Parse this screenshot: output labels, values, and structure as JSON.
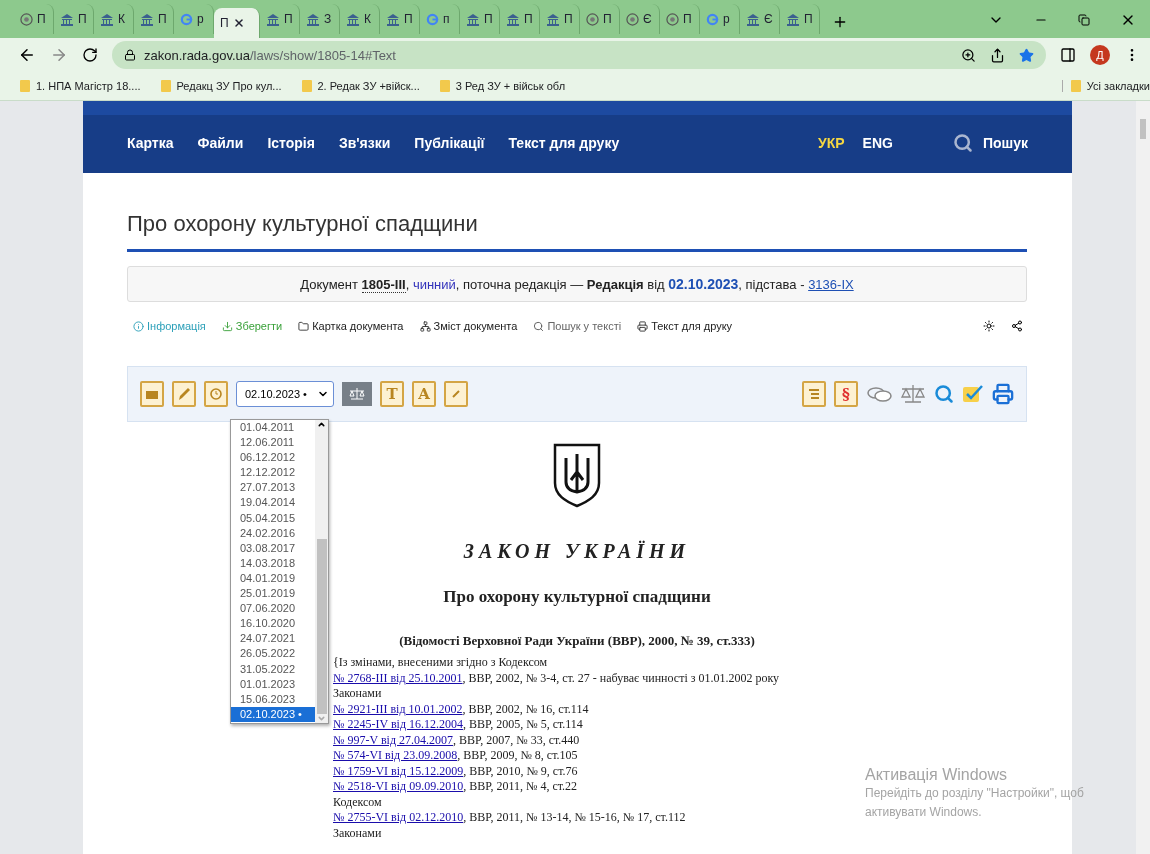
{
  "browser": {
    "tabs": [
      {
        "title": "П",
        "kind": "globe",
        "selected": false
      },
      {
        "title": "П",
        "kind": "building",
        "selected": false
      },
      {
        "title": "К",
        "kind": "building",
        "selected": false
      },
      {
        "title": "П",
        "kind": "building",
        "selected": false
      },
      {
        "title": "р",
        "kind": "google",
        "selected": false
      },
      {
        "title": "П",
        "kind": "plain",
        "selected": true
      },
      {
        "title": "П",
        "kind": "building",
        "selected": false
      },
      {
        "title": "З",
        "kind": "building",
        "selected": false
      },
      {
        "title": "К",
        "kind": "building",
        "selected": false
      },
      {
        "title": "П",
        "kind": "building",
        "selected": false
      },
      {
        "title": "п",
        "kind": "google",
        "selected": false
      },
      {
        "title": "П",
        "kind": "building",
        "selected": false
      },
      {
        "title": "П",
        "kind": "building",
        "selected": false
      },
      {
        "title": "П",
        "kind": "building",
        "selected": false
      },
      {
        "title": "П",
        "kind": "globe",
        "selected": false
      },
      {
        "title": "Є",
        "kind": "globe",
        "selected": false
      },
      {
        "title": "П",
        "kind": "globe",
        "selected": false
      },
      {
        "title": "р",
        "kind": "google",
        "selected": false
      },
      {
        "title": "Є",
        "kind": "building",
        "selected": false
      },
      {
        "title": "П",
        "kind": "building",
        "selected": false
      }
    ],
    "url_host": "zakon.rada.gov.ua",
    "url_path": "/laws/show/1805-14#Text",
    "profile": "Д",
    "bookmarks": [
      "1. НПА Магістр 18....",
      "Редакц ЗУ Про кул...",
      "2. Редак ЗУ +війск...",
      "3 Ред ЗУ + військ обл"
    ],
    "all_bookmarks": "Усі закладки"
  },
  "nav": {
    "items": [
      "Картка",
      "Файли",
      "Історія",
      "Зв'язки",
      "Публікації",
      "Текст для друку"
    ],
    "languages": [
      {
        "label": "УКР",
        "selected": true
      },
      {
        "label": "ENG",
        "selected": false
      }
    ],
    "search": "Пошук"
  },
  "title": "Про охорону культурної спадщини",
  "doc_info": {
    "prefix": "Документ ",
    "number": "1805-III",
    "sep": ", ",
    "status": "чинний",
    "middle": ", поточна редакція — **Редакція** від ",
    "date": "02.10.2023",
    "basis_prefix": ", підстава - ",
    "basis": "3136-IX"
  },
  "actions": [
    {
      "kind": "info",
      "label": "Інформація"
    },
    {
      "kind": "save",
      "label": "Зберегти"
    },
    {
      "kind": "folder",
      "label": "Картка документа"
    },
    {
      "kind": "tree",
      "label": "Зміст документа"
    },
    {
      "kind": "search",
      "label": "Пошук у тексті"
    },
    {
      "kind": "print",
      "label": "Текст для друку"
    }
  ],
  "toolbar": {
    "left": [
      {
        "kind": "archive"
      },
      {
        "kind": "pen"
      },
      {
        "kind": "history"
      }
    ],
    "select_value": "02.10.2023 •",
    "after": [
      {
        "kind": "scales"
      },
      {
        "kind": "letter",
        "label": "T"
      },
      {
        "kind": "letter",
        "label": "A"
      },
      {
        "kind": "link"
      }
    ],
    "right": [
      {
        "kind": "list"
      },
      {
        "kind": "letter",
        "label": "§"
      },
      {
        "kind": "comments"
      },
      {
        "kind": "balance"
      },
      {
        "kind": "search"
      },
      {
        "kind": "check"
      },
      {
        "kind": "print"
      }
    ]
  },
  "dropdown": [
    {
      "label": "01.04.2011",
      "selected": false
    },
    {
      "label": "12.06.2011",
      "selected": false
    },
    {
      "label": "06.12.2012",
      "selected": false
    },
    {
      "label": "12.12.2012",
      "selected": false
    },
    {
      "label": "27.07.2013",
      "selected": false
    },
    {
      "label": "19.04.2014",
      "selected": false
    },
    {
      "label": "05.04.2015",
      "selected": false
    },
    {
      "label": "24.02.2016",
      "selected": false
    },
    {
      "label": "03.08.2017",
      "selected": false
    },
    {
      "label": "14.03.2018",
      "selected": false
    },
    {
      "label": "04.01.2019",
      "selected": false
    },
    {
      "label": "25.01.2019",
      "selected": false
    },
    {
      "label": "07.06.2020",
      "selected": false
    },
    {
      "label": "16.10.2020",
      "selected": false
    },
    {
      "label": "24.07.2021",
      "selected": false
    },
    {
      "label": "26.05.2022",
      "selected": false
    },
    {
      "label": "31.05.2022",
      "selected": false
    },
    {
      "label": "01.01.2023",
      "selected": false
    },
    {
      "label": "15.06.2023",
      "selected": false
    },
    {
      "label": "02.10.2023 •",
      "selected": true
    }
  ],
  "law": {
    "heading": "ЗАКОН УКРАЇНИ",
    "subtitle": "Про охорону культурної спадщини",
    "source": "(Відомості Верховної Ради України (ВВР), 2000, № 39, ст.333)",
    "lines": [
      {
        "kind": "text",
        "text": "{Із змінами, внесеними згідно з Кодексом"
      },
      {
        "kind": "link",
        "link": "№ 2768-III від 25.10.2001",
        "text": ", ВВР, 2002, № 3-4, ст. 27 - набуває чинності з 01.01.2002 року"
      },
      {
        "kind": "text",
        "text": "Законами"
      },
      {
        "kind": "link",
        "link": "№ 2921-III від 10.01.2002",
        "text": ", ВВР, 2002, № 16, ст.114"
      },
      {
        "kind": "link",
        "link": "№ 2245-IV від 16.12.2004",
        "text": ", ВВР, 2005, № 5, ст.114"
      },
      {
        "kind": "link",
        "link": "№ 997-V від 27.04.2007",
        "text": ", ВВР, 2007, № 33, ст.440"
      },
      {
        "kind": "link",
        "link": "№ 574-VI від 23.09.2008",
        "text": ", ВВР, 2009, № 8, ст.105"
      },
      {
        "kind": "link",
        "link": "№ 1759-VI від 15.12.2009",
        "text": ", ВВР, 2010, № 9, ст.76"
      },
      {
        "kind": "link",
        "link": "№ 2518-VI від 09.09.2010",
        "text": ", ВВР, 2011, № 4, ст.22"
      },
      {
        "kind": "text",
        "text": "Кодексом"
      },
      {
        "kind": "link",
        "link": "№ 2755-VI від 02.12.2010",
        "text": ", ВВР, 2011, № 13-14, № 15-16, № 17, ст.112"
      },
      {
        "kind": "text",
        "text": "Законами"
      }
    ]
  },
  "activation": {
    "title": "Активація Windows",
    "text": "Перейдіть до розділу \"Настройки\", щоб активувати Windows."
  }
}
